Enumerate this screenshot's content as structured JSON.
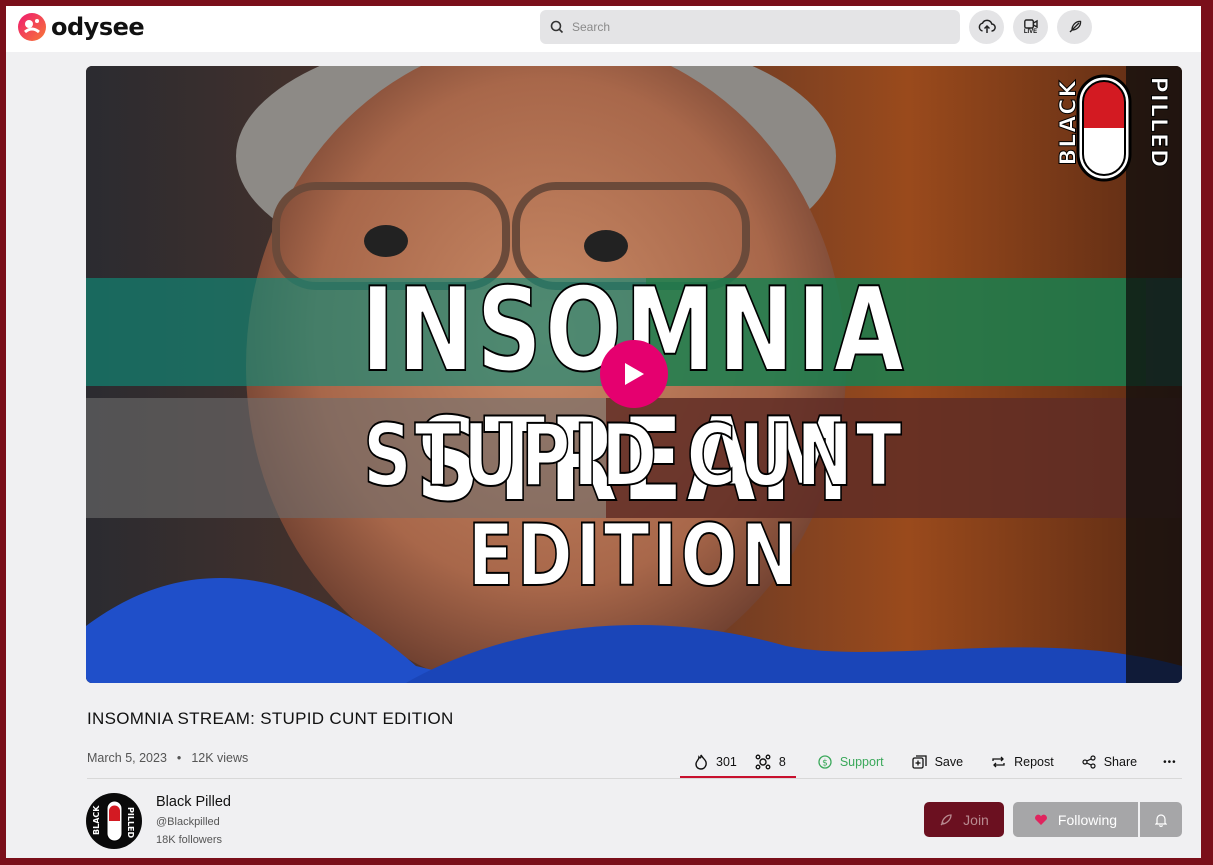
{
  "header": {
    "logo_text": "odysee",
    "search_placeholder": "Search",
    "buttons": [
      {
        "icon": "upload-icon"
      },
      {
        "icon": "go-live-icon",
        "label": "LIVE"
      },
      {
        "icon": "feather-icon"
      }
    ]
  },
  "video": {
    "thumbnail_line1": "INSOMNIA STREAM",
    "thumbnail_line2": "STUPID CUNT EDITION",
    "brand_left": "BLACK",
    "brand_right": "PILLED"
  },
  "title": "INSOMNIA STREAM: STUPID CUNT EDITION",
  "meta": {
    "date": "March 5, 2023",
    "separator": "•",
    "views": "12K views"
  },
  "actions": {
    "fire_count": "301",
    "slime_count": "8",
    "support": "Support",
    "save": "Save",
    "repost": "Repost",
    "share": "Share",
    "more": "•••"
  },
  "channel": {
    "name": "Black Pilled",
    "handle": "@Blackpilled",
    "followers": "18K followers",
    "join_label": "Join",
    "following_label": "Following"
  },
  "colors": {
    "page_frame": "#7a0f1a",
    "accent_pink": "#e5006f",
    "support_green": "#3aa85a",
    "active_underline": "#c8102e"
  }
}
